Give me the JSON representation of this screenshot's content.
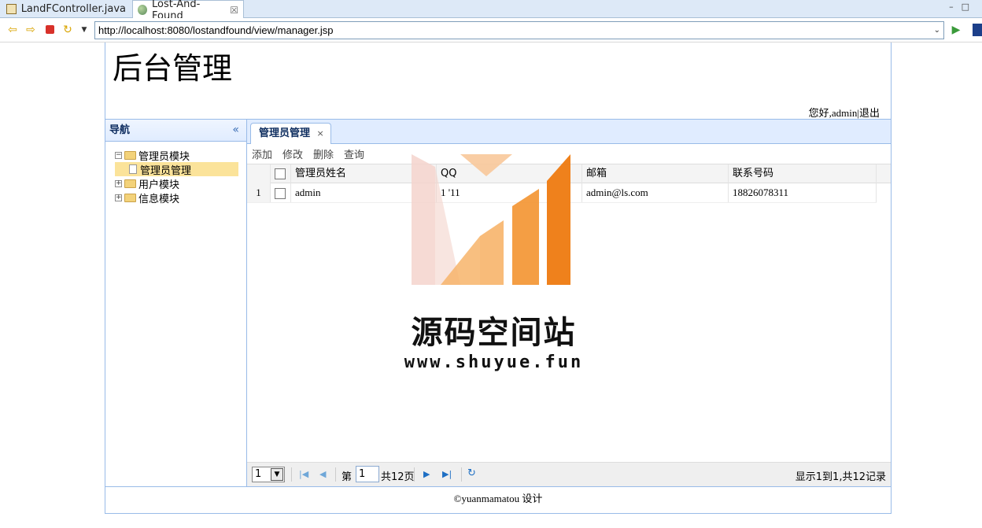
{
  "ide": {
    "tabs": [
      {
        "label": "LandFController.java"
      },
      {
        "label": "Lost-And-Found",
        "close": "☒"
      }
    ],
    "window_controls": "–□"
  },
  "toolbar": {
    "url": "http://localhost:8080/lostandfound/view/manager.jsp"
  },
  "header": {
    "title": "后台管理",
    "greeting": "您好,admin|退出"
  },
  "nav": {
    "title": "导航",
    "tree": [
      {
        "label": "管理员模块",
        "expanded": true
      },
      {
        "label": "管理员管理",
        "selected": true
      },
      {
        "label": "用户模块",
        "expanded": false
      },
      {
        "label": "信息模块",
        "expanded": false
      }
    ]
  },
  "main": {
    "tab": {
      "label": "管理员管理",
      "close": "×"
    },
    "toolbar": [
      "添加",
      "修改",
      "删除",
      "查询"
    ],
    "columns": [
      "管理员姓名",
      "QQ",
      "邮箱",
      "联系号码"
    ],
    "rows": [
      {
        "num": "1",
        "name": "admin",
        "qq": "1  '11",
        "email": "admin@ls.com",
        "phone": "18826078311"
      }
    ],
    "pager": {
      "page_size": "1",
      "page_prefix": "第",
      "page_value": "1",
      "page_total": "共12页",
      "info": "显示1到1,共12记录"
    }
  },
  "footer": {
    "text": "©yuanmamatou 设计"
  },
  "watermark": {
    "name": "源码空间站",
    "url": "www.shuyue.fun",
    "colors": [
      "#f4d4cc",
      "#f7b46a",
      "#f39330",
      "#ee7a10"
    ]
  }
}
